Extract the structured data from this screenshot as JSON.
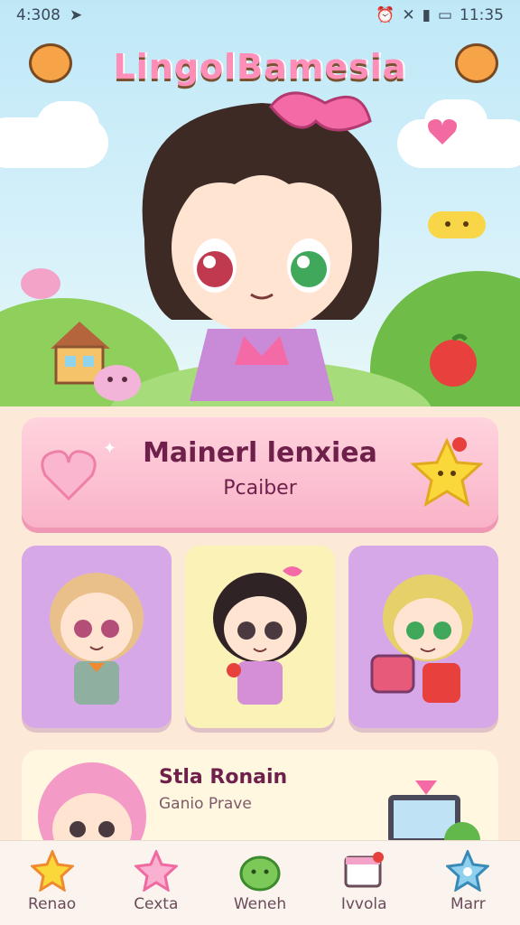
{
  "status_bar": {
    "time_left": "4:308",
    "time_right": "11:35"
  },
  "app": {
    "title": "LingolBamesia"
  },
  "featured": {
    "title": "Mainerl lenxiea",
    "subtitle": "Pcaiber"
  },
  "tiles": [
    {
      "name": "blonde-chibi"
    },
    {
      "name": "dark-hair-chibi"
    },
    {
      "name": "green-eye-chibi"
    }
  ],
  "story_card": {
    "title": "Stla Ronain",
    "subtitle": "Ganio Prave"
  },
  "tabs": [
    {
      "label": "Renao",
      "icon": "star-icon"
    },
    {
      "label": "Cexta",
      "icon": "pink-star-icon"
    },
    {
      "label": "Weneh",
      "icon": "green-blob-icon"
    },
    {
      "label": "Ivvola",
      "icon": "calendar-icon"
    },
    {
      "label": "Marr",
      "icon": "blue-star-icon"
    }
  ],
  "colors": {
    "accent": "#f26aa0",
    "text": "#6e1f4a",
    "sky": "#bfe8f7"
  }
}
